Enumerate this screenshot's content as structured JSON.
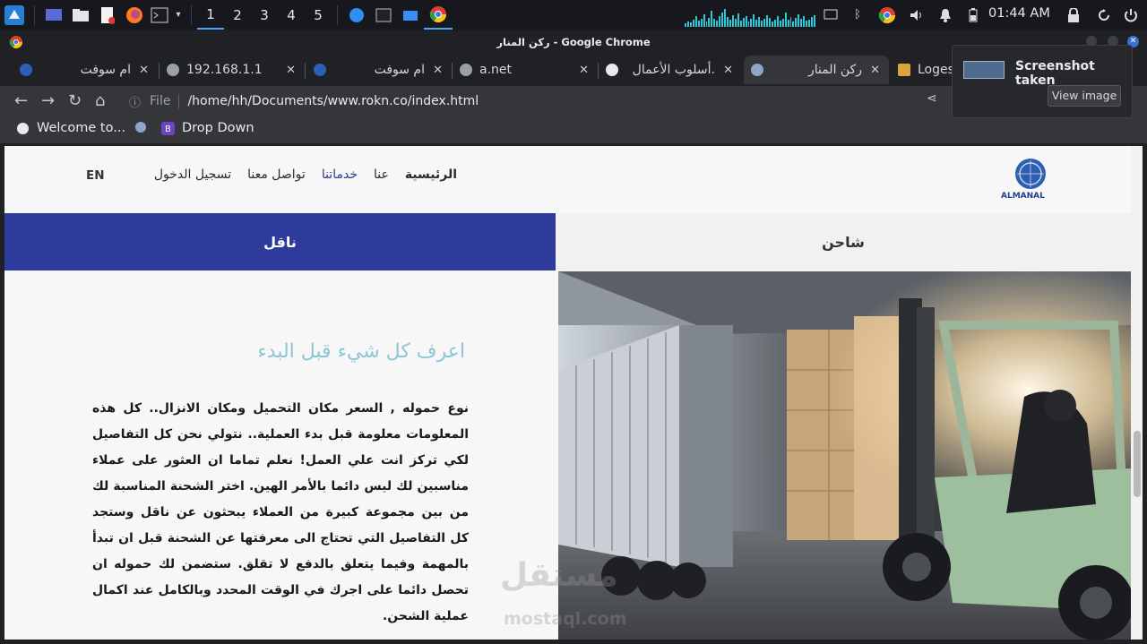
{
  "taskbar": {
    "workspaces": [
      "1",
      "2",
      "3",
      "4",
      "5"
    ],
    "active_workspace": "1",
    "clock": "01:44 AM"
  },
  "window": {
    "title": "ركن المنار - Google Chrome"
  },
  "tabs": [
    {
      "label": "ام سوفت"
    },
    {
      "label": "192.168.1.1"
    },
    {
      "label": "ام سوفت"
    },
    {
      "label": "a.net"
    },
    {
      "label": "أسلوب الأعمال."
    },
    {
      "label": "ركن المنار"
    },
    {
      "label": "Loges"
    }
  ],
  "omnibox": {
    "scheme_label": "File",
    "url": "/home/hh/Documents/www.rokn.co/index.html"
  },
  "bookmarks": [
    {
      "label": "Welcome to..."
    },
    {
      "label": "Drop Down"
    }
  ],
  "notification": {
    "title": "Screenshot taken",
    "action": "View image"
  },
  "site": {
    "nav": {
      "items": [
        "الرئيسية",
        "عنا",
        "خدماتنا",
        "تواصل معنا",
        "تسجيل الدخول"
      ],
      "active": "خدماتنا",
      "lang": "EN"
    },
    "logo_text": "ALMANAL",
    "tabs": {
      "naqel": "ناقل",
      "shahen": "شاحن"
    },
    "heading": "اعرف كل شيء قبل البدء",
    "paragraph": "نوع حموله , السعر مكان التحميل ومكان الانزال.. كل هذه المعلومات معلومة قبل بدء العملية.. نتولي نحن كل التفاصيل لكي تركز انت علي العمل! نعلم تماما ان العثور على عملاء مناسبين لك ليس دائما بالأمر الهين. اختر الشحنة المناسبة لك من بين مجموعة كبيرة من العملاء يبحثون عن ناقل وستجد كل التفاصيل التي تحتاج الى معرفتها عن الشحنة قبل ان تبدأ بالمهمة وفيما يتعلق بالدفع لا تقلق. ستضمن لك حموله ان تحصل دائما على اجرك في الوقت المحدد وبالكامل عند اكمال عملية الشحن."
  },
  "watermark": {
    "line1": "مستقل",
    "line2": "mostaql.com"
  }
}
